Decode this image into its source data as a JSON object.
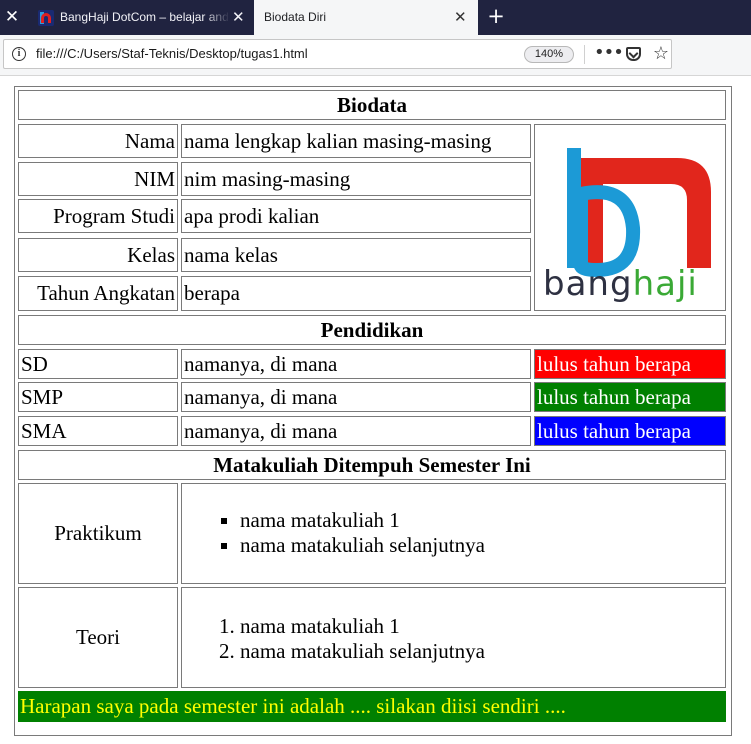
{
  "browser": {
    "tabs": [
      {
        "title": "BangHaji DotCom – belajar and",
        "active": false
      },
      {
        "title": "Biodata Diri",
        "active": true
      }
    ],
    "url": "file:///C:/Users/Staf-Teknis/Desktop/tugas1.html",
    "zoom": "140%",
    "icons": [
      "close-icon",
      "new-tab-icon",
      "info-icon",
      "more-icon",
      "pocket-icon",
      "star-icon"
    ]
  },
  "page": {
    "biodata_title": "Biodata",
    "biodata": [
      {
        "label": "Nama",
        "value": "nama lengkap kalian masing-masing"
      },
      {
        "label": "NIM",
        "value": "nim masing-masing"
      },
      {
        "label": "Program Studi",
        "value": "apa prodi kalian"
      },
      {
        "label": "Kelas",
        "value": "nama kelas"
      },
      {
        "label": "Tahun Angkatan",
        "value": "berapa"
      }
    ],
    "logo": {
      "text_dark": "bang",
      "text_green": "haji",
      "colors": {
        "blue": "#1c9ad6",
        "red": "#e1261c",
        "dark": "#2e3142",
        "green": "#3aa935"
      }
    },
    "pendidikan_title": "Pendidikan",
    "pendidikan": [
      {
        "level": "SD",
        "school": "namanya, di mana",
        "year": "lulus tahun berapa",
        "color": "#ff0000"
      },
      {
        "level": "SMP",
        "school": "namanya, di mana",
        "year": "lulus tahun berapa",
        "color": "#008000"
      },
      {
        "level": "SMA",
        "school": "namanya, di mana",
        "year": "lulus tahun berapa",
        "color": "#0000ff"
      }
    ],
    "matakuliah_title": "Matakuliah Ditempuh Semester Ini",
    "praktikum": {
      "label": "Praktikum",
      "items": [
        "nama matakuliah 1",
        "nama matakuliah selanjutnya"
      ]
    },
    "teori": {
      "label": "Teori",
      "items": [
        "nama matakuliah 1",
        "nama matakuliah selanjutnya"
      ]
    },
    "harapan": "Harapan saya pada semester ini adalah .... silakan diisi sendiri ....",
    "harapan_colors": {
      "background": "#008000",
      "text": "#ffff00"
    }
  }
}
